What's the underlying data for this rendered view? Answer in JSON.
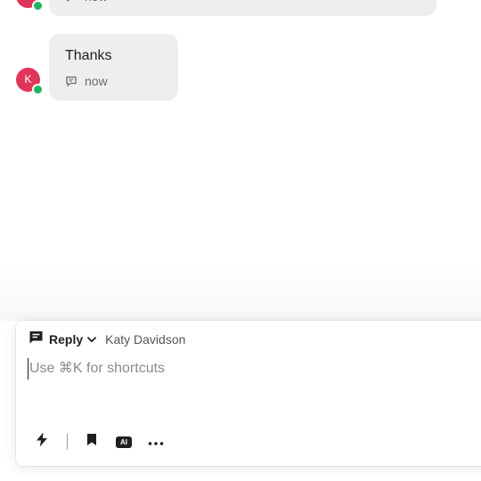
{
  "conversation": {
    "messages": [
      {
        "author_initial": "",
        "text": "",
        "time": "now"
      },
      {
        "author_initial": "K",
        "text": "Thanks",
        "time": "now"
      }
    ]
  },
  "composer": {
    "mode_label": "Reply",
    "recipient": "Katy Davidson",
    "placeholder": "Use ⌘K for shortcuts",
    "tools": {
      "ai_label": "AI"
    }
  },
  "colors": {
    "avatar": "#e0355a",
    "presence": "#22b35e",
    "bubble": "#eeeeee"
  },
  "icons": [
    "message-icon",
    "chat-icon",
    "chevron-down-icon",
    "lightning-icon",
    "bookmark-icon",
    "ai-icon",
    "more-icon"
  ]
}
